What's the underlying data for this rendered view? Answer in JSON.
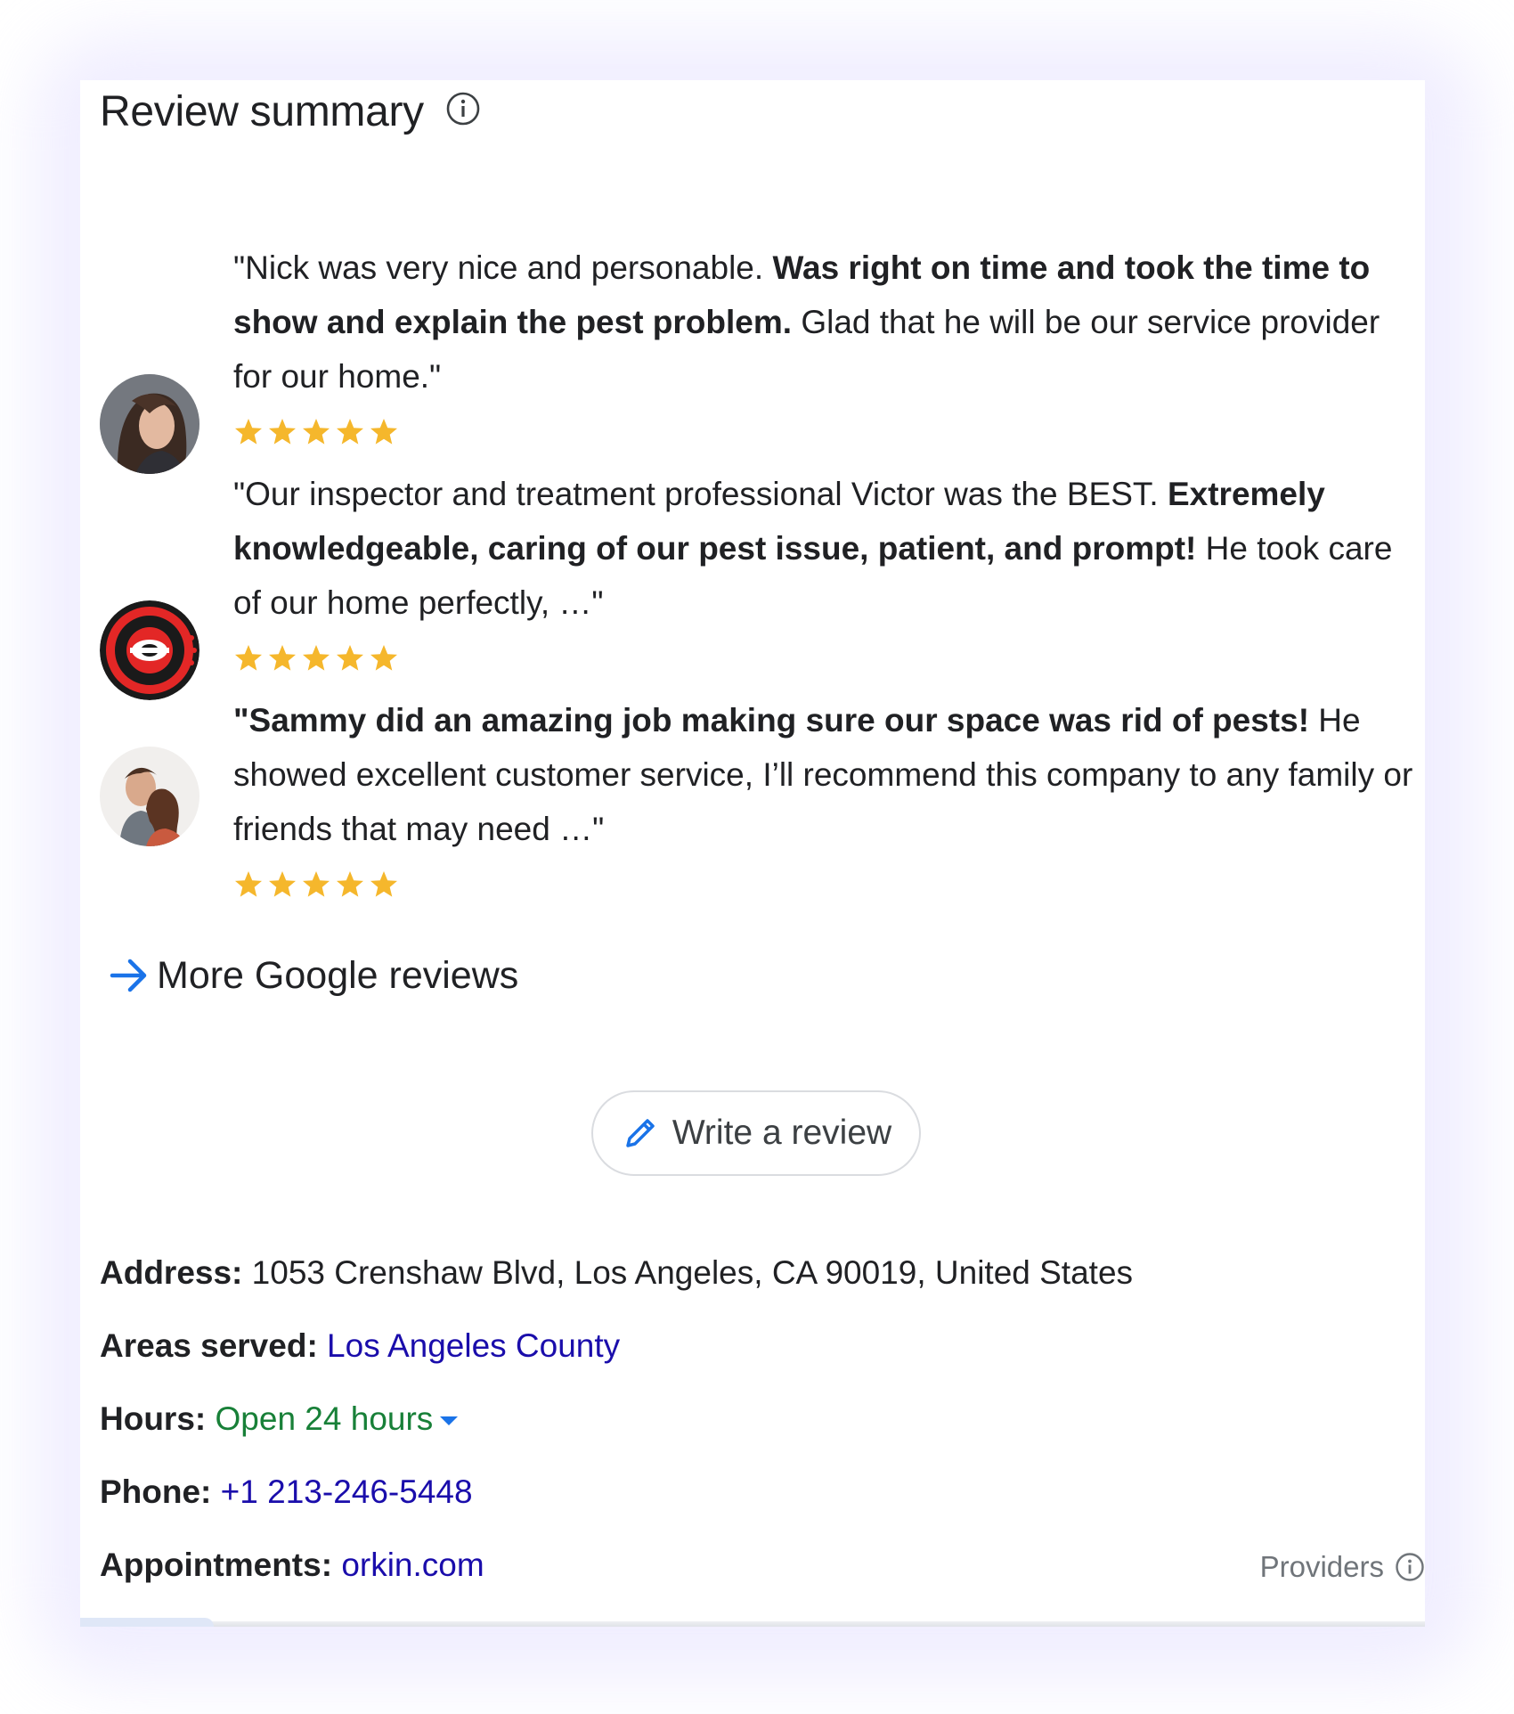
{
  "section": {
    "title": "Review summary"
  },
  "reviews": [
    {
      "parts": [
        {
          "text": "\"Nick was very nice and personable. ",
          "bold": false
        },
        {
          "text": "Was right on time and took the time to show and explain the pest problem.",
          "bold": true
        },
        {
          "text": " Glad that he will be our service provider for our home.\"",
          "bold": false
        }
      ],
      "rating": 5,
      "avatar": "woman-portrait"
    },
    {
      "parts": [
        {
          "text": "\"Our inspector and treatment professional Victor was the BEST. ",
          "bold": false
        },
        {
          "text": "Extremely knowledgeable, caring of our pest issue, patient, and prompt!",
          "bold": true
        },
        {
          "text": " He took care of our home perfectly, …\"",
          "bold": false
        }
      ],
      "rating": 5,
      "avatar": "orkin-logo"
    },
    {
      "parts": [
        {
          "text": "\"Sammy did an amazing job making sure our space was rid of pests!",
          "bold": true
        },
        {
          "text": " He showed excellent customer service, I’ll recommend this company to any family or friends that may need …\"",
          "bold": false
        }
      ],
      "rating": 5,
      "avatar": "couple-portrait"
    }
  ],
  "more_reviews_label": "More Google reviews",
  "write_review_label": "Write a review",
  "details": {
    "address_label": "Address:",
    "address_value": "1053 Crenshaw Blvd, Los Angeles, CA 90019, United States",
    "areas_label": "Areas served:",
    "areas_value": "Los Angeles County",
    "hours_label": "Hours:",
    "hours_value": "Open 24 hours",
    "phone_label": "Phone:",
    "phone_value": "+1 213-246-5448",
    "appointments_label": "Appointments:",
    "appointments_value": "orkin.com"
  },
  "providers_label": "Providers",
  "colors": {
    "star": "#f5b72c",
    "link_blue": "#1a0dab",
    "open_green": "#188038",
    "accent_blue": "#1a73e8"
  }
}
